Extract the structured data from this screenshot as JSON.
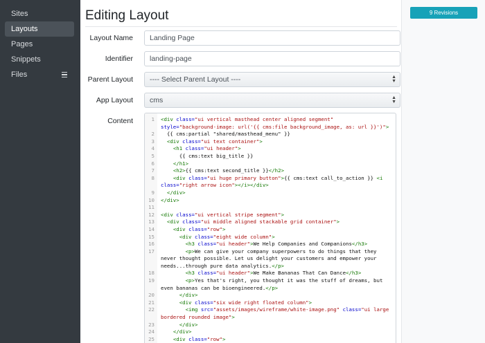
{
  "sidebar": {
    "items": [
      {
        "label": "Sites"
      },
      {
        "label": "Layouts"
      },
      {
        "label": "Pages"
      },
      {
        "label": "Snippets"
      },
      {
        "label": "Files"
      }
    ]
  },
  "header": {
    "title": "Editing Layout"
  },
  "form": {
    "layout_name": {
      "label": "Layout Name",
      "value": "Landing Page"
    },
    "identifier": {
      "label": "Identifier",
      "value": "landing-page"
    },
    "parent_layout": {
      "label": "Parent Layout",
      "value": "---- Select Parent Layout ----"
    },
    "app_layout": {
      "label": "App Layout",
      "value": "cms"
    },
    "content": {
      "label": "Content"
    }
  },
  "editor": {
    "lines": [
      {
        "n": "1",
        "html": "<span class=\"t\">&lt;div</span> <span class=\"a\">class=</span><span class=\"s\">\"ui vertical masthead center aligned segment\"</span> <span class=\"a\">style=</span><span class=\"s\">\"background-image: url('{{ cms:file background_image, as: url }}')\"</span><span class=\"t\">&gt;</span>"
      },
      {
        "n": "2",
        "html": "  {{ cms:partial \"shared/masthead_menu\" }}"
      },
      {
        "n": "3",
        "html": "  <span class=\"t\">&lt;div</span> <span class=\"a\">class=</span><span class=\"s\">\"ui text container\"</span><span class=\"t\">&gt;</span>"
      },
      {
        "n": "4",
        "html": "    <span class=\"t\">&lt;h1</span> <span class=\"a\">class=</span><span class=\"s\">\"ui header\"</span><span class=\"t\">&gt;</span>"
      },
      {
        "n": "5",
        "html": "      {{ cms:text big_title }}"
      },
      {
        "n": "6",
        "html": "    <span class=\"t\">&lt;/h1&gt;</span>"
      },
      {
        "n": "7",
        "html": "    <span class=\"t\">&lt;h2&gt;</span>{{ cms:text second_title }}<span class=\"t\">&lt;/h2&gt;</span>"
      },
      {
        "n": "8",
        "html": "    <span class=\"t\">&lt;div</span> <span class=\"a\">class=</span><span class=\"s\">\"ui huge primary button\"</span><span class=\"t\">&gt;</span>{{ cms:text call_to_action }} <span class=\"t\">&lt;i</span> <span class=\"a\">class=</span><span class=\"s\">\"right arrow icon\"</span><span class=\"t\">&gt;&lt;/i&gt;&lt;/div&gt;</span>"
      },
      {
        "n": "9",
        "html": "  <span class=\"t\">&lt;/div&gt;</span>"
      },
      {
        "n": "10",
        "html": "<span class=\"t\">&lt;/div&gt;</span>"
      },
      {
        "n": "11",
        "html": ""
      },
      {
        "n": "12",
        "html": "<span class=\"t\">&lt;div</span> <span class=\"a\">class=</span><span class=\"s\">\"ui vertical stripe segment\"</span><span class=\"t\">&gt;</span>"
      },
      {
        "n": "13",
        "html": "  <span class=\"t\">&lt;div</span> <span class=\"a\">class=</span><span class=\"s\">\"ui middle aligned stackable grid container\"</span><span class=\"t\">&gt;</span>"
      },
      {
        "n": "14",
        "html": "    <span class=\"t\">&lt;div</span> <span class=\"a\">class=</span><span class=\"s\">\"row\"</span><span class=\"t\">&gt;</span>"
      },
      {
        "n": "15",
        "html": "      <span class=\"t\">&lt;div</span> <span class=\"a\">class=</span><span class=\"s\">\"eight wide column\"</span><span class=\"t\">&gt;</span>"
      },
      {
        "n": "16",
        "html": "        <span class=\"t\">&lt;h3</span> <span class=\"a\">class=</span><span class=\"s\">\"ui header\"</span><span class=\"t\">&gt;</span>We Help Companies and Companions<span class=\"t\">&lt;/h3&gt;</span>"
      },
      {
        "n": "17",
        "html": "        <span class=\"t\">&lt;p&gt;</span>We can give your company superpowers to do things that they never thought possible. Let us delight your customers and empower your needs...through pure data analytics.<span class=\"t\">&lt;/p&gt;</span>"
      },
      {
        "n": "18",
        "html": "        <span class=\"t\">&lt;h3</span> <span class=\"a\">class=</span><span class=\"s\">\"ui header\"</span><span class=\"t\">&gt;</span>We Make Bananas That Can Dance<span class=\"t\">&lt;/h3&gt;</span>"
      },
      {
        "n": "19",
        "html": "        <span class=\"t\">&lt;p&gt;</span>Yes that's right, you thought it was the stuff of dreams, but even bananas can be bioengineered.<span class=\"t\">&lt;/p&gt;</span>"
      },
      {
        "n": "20",
        "html": "      <span class=\"t\">&lt;/div&gt;</span>"
      },
      {
        "n": "21",
        "html": "      <span class=\"t\">&lt;div</span> <span class=\"a\">class=</span><span class=\"s\">\"six wide right floated column\"</span><span class=\"t\">&gt;</span>"
      },
      {
        "n": "22",
        "html": "        <span class=\"t\">&lt;img</span> <span class=\"a\">src=</span><span class=\"s\">\"assets/images/wireframe/white-image.png\"</span> <span class=\"a\">class=</span><span class=\"s\">\"ui large bordered rounded image\"</span><span class=\"t\">&gt;</span>"
      },
      {
        "n": "23",
        "html": "      <span class=\"t\">&lt;/div&gt;</span>"
      },
      {
        "n": "24",
        "html": "    <span class=\"t\">&lt;/div&gt;</span>"
      },
      {
        "n": "25",
        "html": "    <span class=\"t\">&lt;div</span> <span class=\"a\">class=</span><span class=\"s\">\"row\"</span><span class=\"t\">&gt;</span>"
      }
    ]
  },
  "revisions": {
    "label": "9 Revisions"
  },
  "colors": {
    "sidebar": "#343a40",
    "accent": "#17a2b8",
    "tag": "#117700",
    "attr": "#0000cc",
    "string": "#aa1111"
  }
}
